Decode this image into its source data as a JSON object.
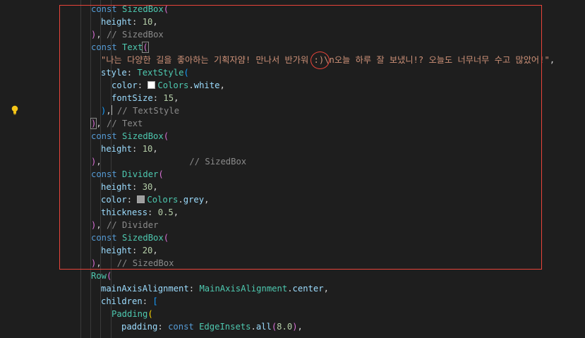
{
  "editor": {
    "lines": [
      {
        "indent": 129,
        "tokens": [
          {
            "t": "const ",
            "c": "kw"
          },
          {
            "t": "SizedBox",
            "c": "cls"
          },
          {
            "t": "(",
            "c": "b2"
          }
        ]
      },
      {
        "indent": 143,
        "tokens": [
          {
            "t": "height",
            "c": "prop"
          },
          {
            "t": ": ",
            "c": "pun"
          },
          {
            "t": "10",
            "c": "num"
          },
          {
            "t": ",",
            "c": "pun"
          }
        ]
      },
      {
        "indent": 129,
        "tokens": [
          {
            "t": ")",
            "c": "b2"
          },
          {
            "t": ", ",
            "c": "pun"
          },
          {
            "t": "// SizedBox",
            "c": "cmt"
          }
        ]
      },
      {
        "indent": 129,
        "tokens": [
          {
            "t": "const ",
            "c": "kw"
          },
          {
            "t": "Text",
            "c": "cls"
          },
          {
            "t": "(",
            "c": "b2",
            "hl": true
          }
        ]
      },
      {
        "indent": 143,
        "tokens": [
          {
            "t": "\"나는 다양한 길을 좋아하는 기획자얌! 만나서 반가워 :)\\n오늘 하루 잘 보냈니!? 오늘도 너무너무 수고 많았어!\"",
            "c": "str"
          },
          {
            "t": ",",
            "c": "pun"
          }
        ]
      },
      {
        "indent": 143,
        "tokens": [
          {
            "t": "style",
            "c": "prop"
          },
          {
            "t": ": ",
            "c": "pun"
          },
          {
            "t": "TextStyle",
            "c": "cls"
          },
          {
            "t": "(",
            "c": "b3"
          }
        ]
      },
      {
        "indent": 158,
        "tokens": [
          {
            "t": "color",
            "c": "prop"
          },
          {
            "t": ": ",
            "c": "pun"
          },
          {
            "t": "",
            "c": "swatch",
            "col": "#ffffff"
          },
          {
            "t": "Colors",
            "c": "cls"
          },
          {
            "t": ".",
            "c": "pun"
          },
          {
            "t": "white",
            "c": "prop"
          },
          {
            "t": ",",
            "c": "pun"
          }
        ]
      },
      {
        "indent": 158,
        "tokens": [
          {
            "t": "fontSize",
            "c": "prop"
          },
          {
            "t": ": ",
            "c": "pun"
          },
          {
            "t": "15",
            "c": "num"
          },
          {
            "t": ",",
            "c": "pun"
          }
        ]
      },
      {
        "indent": 143,
        "tokens": [
          {
            "t": ")",
            "c": "b3"
          },
          {
            "t": ",",
            "c": "pun"
          },
          {
            "t": "",
            "c": "cursor"
          },
          {
            "t": " // TextStyle",
            "c": "cmt"
          }
        ]
      },
      {
        "indent": 129,
        "tokens": [
          {
            "t": ")",
            "c": "b2",
            "hl": true
          },
          {
            "t": ", ",
            "c": "pun"
          },
          {
            "t": "// Text",
            "c": "cmt"
          }
        ]
      },
      {
        "indent": 129,
        "tokens": [
          {
            "t": "const ",
            "c": "kw"
          },
          {
            "t": "SizedBox",
            "c": "cls"
          },
          {
            "t": "(",
            "c": "b2"
          }
        ]
      },
      {
        "indent": 143,
        "tokens": [
          {
            "t": "height",
            "c": "prop"
          },
          {
            "t": ": ",
            "c": "pun"
          },
          {
            "t": "10",
            "c": "num"
          },
          {
            "t": ",",
            "c": "pun"
          }
        ]
      },
      {
        "indent": 129,
        "tokens": [
          {
            "t": ")",
            "c": "b2"
          },
          {
            "t": ",                 ",
            "c": "pun"
          },
          {
            "t": "// SizedBox",
            "c": "cmt"
          }
        ]
      },
      {
        "indent": 129,
        "tokens": [
          {
            "t": "const ",
            "c": "kw"
          },
          {
            "t": "Divider",
            "c": "cls"
          },
          {
            "t": "(",
            "c": "b2"
          }
        ]
      },
      {
        "indent": 143,
        "tokens": [
          {
            "t": "height",
            "c": "prop"
          },
          {
            "t": ": ",
            "c": "pun"
          },
          {
            "t": "30",
            "c": "num"
          },
          {
            "t": ",",
            "c": "pun"
          }
        ]
      },
      {
        "indent": 143,
        "tokens": [
          {
            "t": "color",
            "c": "prop"
          },
          {
            "t": ": ",
            "c": "pun"
          },
          {
            "t": "",
            "c": "swatch",
            "col": "#9e9e9e"
          },
          {
            "t": "Colors",
            "c": "cls"
          },
          {
            "t": ".",
            "c": "pun"
          },
          {
            "t": "grey",
            "c": "prop"
          },
          {
            "t": ",",
            "c": "pun"
          }
        ]
      },
      {
        "indent": 143,
        "tokens": [
          {
            "t": "thickness",
            "c": "prop"
          },
          {
            "t": ": ",
            "c": "pun"
          },
          {
            "t": "0.5",
            "c": "num"
          },
          {
            "t": ",",
            "c": "pun"
          }
        ]
      },
      {
        "indent": 129,
        "tokens": [
          {
            "t": ")",
            "c": "b2"
          },
          {
            "t": ", ",
            "c": "pun"
          },
          {
            "t": "// Divider",
            "c": "cmt"
          }
        ]
      },
      {
        "indent": 129,
        "tokens": [
          {
            "t": "const ",
            "c": "kw"
          },
          {
            "t": "SizedBox",
            "c": "cls"
          },
          {
            "t": "(",
            "c": "b2"
          }
        ]
      },
      {
        "indent": 143,
        "tokens": [
          {
            "t": "height",
            "c": "prop"
          },
          {
            "t": ": ",
            "c": "pun"
          },
          {
            "t": "20",
            "c": "num"
          },
          {
            "t": ",",
            "c": "pun"
          }
        ]
      },
      {
        "indent": 129,
        "tokens": [
          {
            "t": ")",
            "c": "b2"
          },
          {
            "t": ",   ",
            "c": "pun"
          },
          {
            "t": "// SizedBox",
            "c": "cmt"
          }
        ]
      },
      {
        "indent": 129,
        "tokens": [
          {
            "t": "Row",
            "c": "cls"
          },
          {
            "t": "(",
            "c": "b2"
          }
        ]
      },
      {
        "indent": 143,
        "tokens": [
          {
            "t": "mainAxisAlignment",
            "c": "prop"
          },
          {
            "t": ": ",
            "c": "pun"
          },
          {
            "t": "MainAxisAlignment",
            "c": "cls"
          },
          {
            "t": ".",
            "c": "pun"
          },
          {
            "t": "center",
            "c": "prop"
          },
          {
            "t": ",",
            "c": "pun"
          }
        ]
      },
      {
        "indent": 143,
        "tokens": [
          {
            "t": "children",
            "c": "prop"
          },
          {
            "t": ": ",
            "c": "pun"
          },
          {
            "t": "[",
            "c": "b3"
          }
        ]
      },
      {
        "indent": 158,
        "tokens": [
          {
            "t": "Padding",
            "c": "cls"
          },
          {
            "t": "(",
            "c": "b1"
          }
        ]
      },
      {
        "indent": 172,
        "tokens": [
          {
            "t": "padding",
            "c": "prop"
          },
          {
            "t": ": ",
            "c": "pun"
          },
          {
            "t": "const ",
            "c": "kw"
          },
          {
            "t": "EdgeInsets",
            "c": "cls"
          },
          {
            "t": ".",
            "c": "pun"
          },
          {
            "t": "all",
            "c": "prop"
          },
          {
            "t": "(",
            "c": "b2"
          },
          {
            "t": "8.0",
            "c": "num"
          },
          {
            "t": ")",
            "c": "b2"
          },
          {
            "t": ",",
            "c": "pun"
          }
        ]
      }
    ]
  }
}
